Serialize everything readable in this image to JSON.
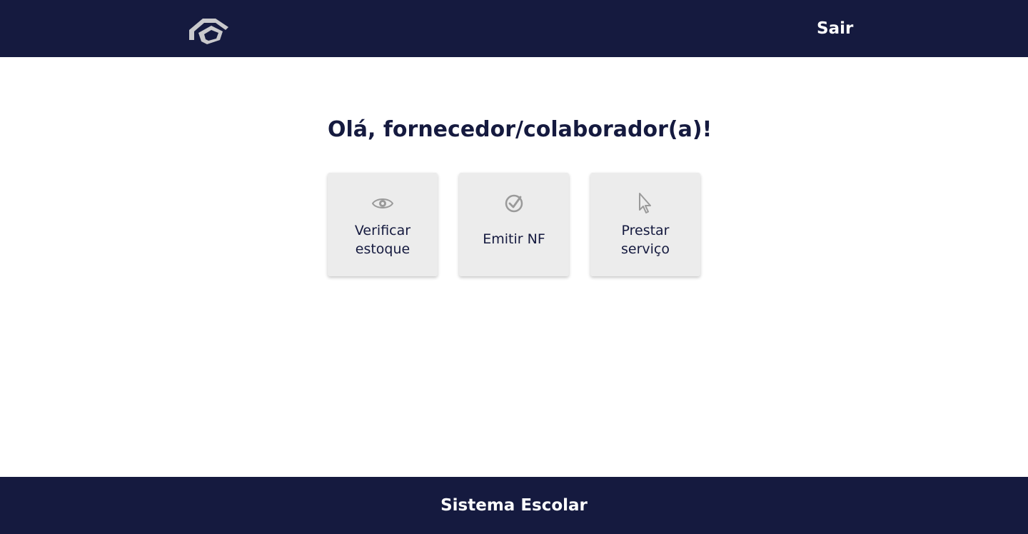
{
  "header": {
    "logo_icon": "graduation-cap-icon",
    "logout_label": "Sair"
  },
  "main": {
    "greeting": "Olá, fornecedor/colaborador(a)!",
    "cards": [
      {
        "icon": "eye-icon",
        "label_line1": "Verificar",
        "label_line2": "estoque"
      },
      {
        "icon": "check-circle-icon",
        "label_line1": "Emitir NF"
      },
      {
        "icon": "cursor-icon",
        "label_line1": "Prestar",
        "label_line2": "serviço"
      }
    ]
  },
  "footer": {
    "text": "Sistema Escolar"
  },
  "colors": {
    "primary": "#151a3f",
    "card_background": "#ececec",
    "icon_gray": "#9a9a9a"
  }
}
